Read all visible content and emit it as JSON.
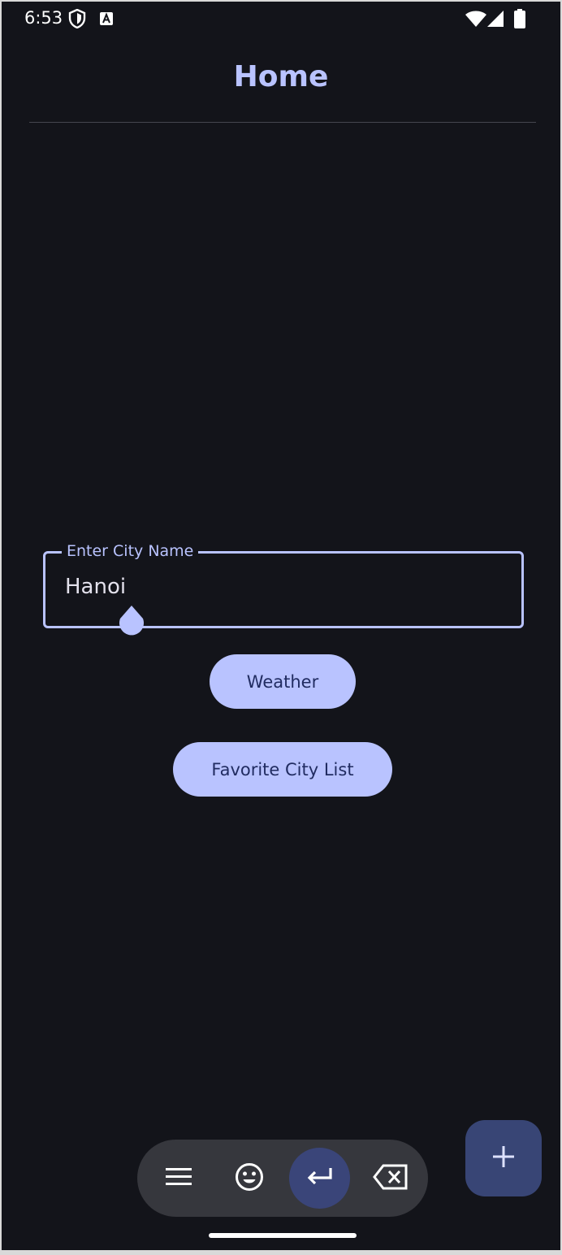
{
  "status_bar": {
    "time": "6:53",
    "icons": [
      "shield-icon",
      "a-icon",
      "wifi-icon",
      "signal-icon",
      "battery-icon"
    ]
  },
  "header": {
    "title": "Home"
  },
  "city_input": {
    "label": "Enter City Name",
    "value": "Hanoi"
  },
  "buttons": {
    "weather_label": "Weather",
    "favorite_label": "Favorite City List"
  },
  "keyboard_toolbar": {
    "icons": [
      "menu-icon",
      "emoji-icon",
      "enter-icon",
      "backspace-icon"
    ]
  },
  "fab": {
    "icon": "plus-icon"
  },
  "colors": {
    "background": "#13141a",
    "accent": "#b9c3ff",
    "button_text": "#212c61",
    "fab": "#384575",
    "toolbar": "#36373d"
  }
}
